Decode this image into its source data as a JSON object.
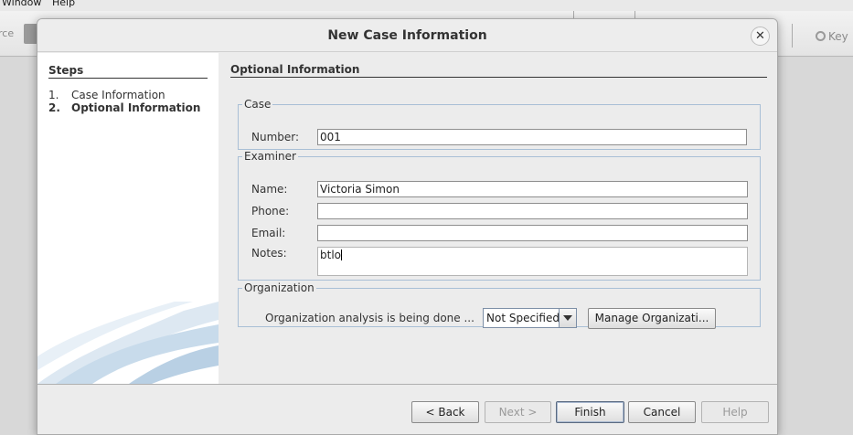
{
  "app": {
    "menu": {
      "window": "Window",
      "help": "Help"
    },
    "toolbar_left_text": "rce",
    "toolbar_search_text": "Key"
  },
  "dialog": {
    "title": "New Case Information",
    "close_symbol": "✕",
    "steps": {
      "title": "Steps",
      "items": [
        {
          "number": "1.",
          "label": "Case Information"
        },
        {
          "number": "2.",
          "label": "Optional Information"
        }
      ]
    },
    "content": {
      "heading": "Optional Information",
      "case": {
        "legend": "Case",
        "number_label": "Number:",
        "number_value": "001"
      },
      "examiner": {
        "legend": "Examiner",
        "name_label": "Name:",
        "name_value": "Victoria Simon",
        "phone_label": "Phone:",
        "phone_value": "",
        "email_label": "Email:",
        "email_value": "",
        "notes_label": "Notes:",
        "notes_value": "btlo"
      },
      "organization": {
        "legend": "Organization",
        "label": "Organization analysis is being done ...",
        "selected": "Not Specified",
        "manage_button": "Manage Organizati..."
      }
    },
    "buttons": {
      "back": "< Back",
      "next": "Next >",
      "finish": "Finish",
      "cancel": "Cancel",
      "help": "Help"
    }
  }
}
